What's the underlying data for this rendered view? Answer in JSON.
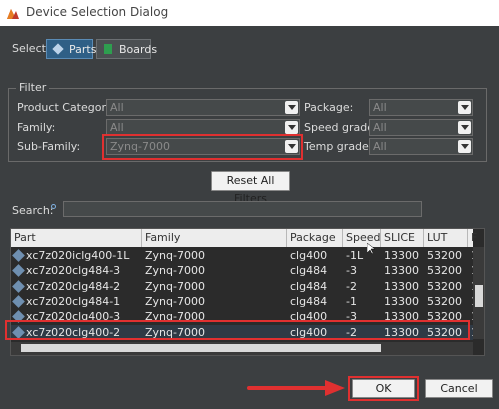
{
  "window": {
    "title": "Device Selection Dialog"
  },
  "select": {
    "label": "Select:",
    "parts": "Parts",
    "boards": "Boards"
  },
  "filter": {
    "title": "Filter",
    "product_category": {
      "label": "Product Category:",
      "value": "All"
    },
    "family": {
      "label": "Family:",
      "value": "All"
    },
    "sub_family": {
      "label": "Sub-Family:",
      "value": "Zynq-7000"
    },
    "package": {
      "label": "Package:",
      "value": "All"
    },
    "speed_grade": {
      "label": "Speed grade:",
      "value": "All"
    },
    "temp_grade": {
      "label": "Temp grade:",
      "value": "All"
    },
    "reset": "Reset All Filters"
  },
  "search": {
    "label": "Search:",
    "value": ""
  },
  "table": {
    "columns": [
      "Part",
      "Family",
      "Package",
      "Speed",
      "SLICE",
      "LUT",
      "F"
    ],
    "rows": [
      [
        "xc7z020iclg400-1L",
        "Zynq-7000",
        "clg400",
        "-1L",
        "13300",
        "53200",
        "1"
      ],
      [
        "xc7z020clg484-3",
        "Zynq-7000",
        "clg484",
        "-3",
        "13300",
        "53200",
        "1"
      ],
      [
        "xc7z020clg484-2",
        "Zynq-7000",
        "clg484",
        "-2",
        "13300",
        "53200",
        "1"
      ],
      [
        "xc7z020clg484-1",
        "Zynq-7000",
        "clg484",
        "-1",
        "13300",
        "53200",
        "1"
      ],
      [
        "xc7z020clg400-3",
        "Zynq-7000",
        "clg400",
        "-3",
        "13300",
        "53200",
        "1"
      ],
      [
        "xc7z020clg400-2",
        "Zynq-7000",
        "clg400",
        "-2",
        "13300",
        "53200",
        "1"
      ]
    ],
    "selected_row": 5
  },
  "buttons": {
    "ok": "OK",
    "cancel": "Cancel"
  },
  "colors": {
    "background": "#3c3f41",
    "highlight": "#e03030",
    "selected": "#2f5f86"
  }
}
